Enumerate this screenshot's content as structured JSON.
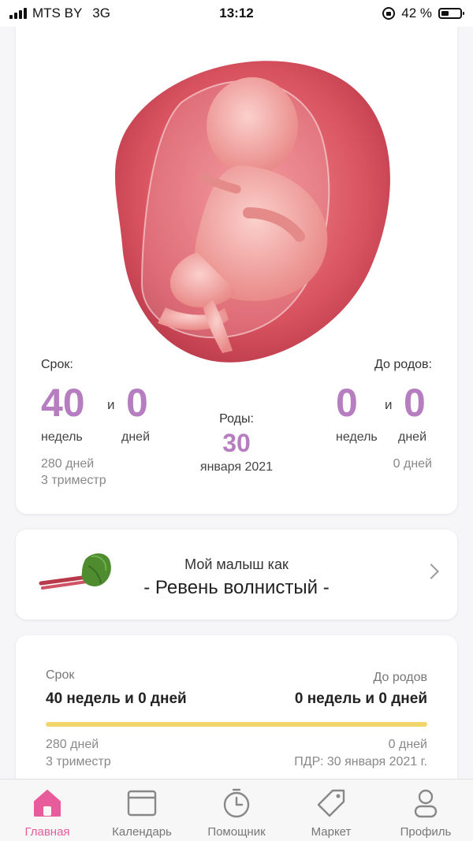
{
  "status_bar": {
    "carrier": "MTS BY",
    "network": "3G",
    "time": "13:12",
    "battery_percent": "42 %",
    "battery_level": 0.42
  },
  "pregnancy": {
    "term_label": "Срок:",
    "weeks": "40",
    "and1": "и",
    "days": "0",
    "weeks_unit": "недель",
    "days_unit": "дней",
    "total_days": "280 дней",
    "trimester": "3 триместр",
    "birth_label": "Роды:",
    "birth_day": "30",
    "birth_month_year": "января 2021",
    "until_label": "До родов:",
    "until_weeks": "0",
    "and2": "и",
    "until_days": "0",
    "until_weeks_unit": "недель",
    "until_days_unit": "дней",
    "until_total": "0 дней"
  },
  "baby_size": {
    "title": "Мой малыш как",
    "name": "- Ревень волнистый -"
  },
  "progress_card": {
    "term_label": "Срок",
    "term_value": "40 недель и 0 дней",
    "until_label": "До родов",
    "until_value": "0 недель и 0 дней",
    "progress": 1.0,
    "total_days": "280 дней",
    "trimester": "3 триместр",
    "until_days": "0 дней",
    "due_date": "ПДР: 30 января 2021 г."
  },
  "tabs": [
    {
      "label": "Главная",
      "icon": "home-icon",
      "active": true
    },
    {
      "label": "Календарь",
      "icon": "calendar-icon",
      "active": false
    },
    {
      "label": "Помощник",
      "icon": "timer-icon",
      "active": false
    },
    {
      "label": "Маркет",
      "icon": "tag-icon",
      "active": false
    },
    {
      "label": "Профиль",
      "icon": "profile-icon",
      "active": false
    }
  ],
  "colors": {
    "accent": "#b67ec1",
    "active_tab": "#e85c9c",
    "progress": "#f2d56b"
  }
}
